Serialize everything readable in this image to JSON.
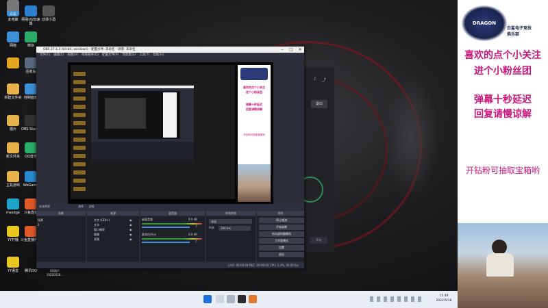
{
  "desktop": {
    "icons": [
      {
        "label": "此电脑",
        "color": "#3d8fd6"
      },
      {
        "label": "网易UU加速器",
        "color": "#2d7fd1"
      },
      {
        "label": "动漫小酒",
        "color": "#555"
      },
      {
        "label": "网络",
        "color": "#3d8fd6"
      },
      {
        "label": "微信",
        "color": "#2aae67"
      },
      {
        "label": "",
        "color": "#e1a520"
      },
      {
        "label": "回收站",
        "color": "#5a6a80"
      },
      {
        "label": "新建文件夹",
        "color": "#e8b34a"
      },
      {
        "label": "控制面板",
        "color": "#3d8fd6"
      },
      {
        "label": "图片",
        "color": "#e8b34a"
      },
      {
        "label": "OBS Studio",
        "color": "#333"
      },
      {
        "label": "新文件夹",
        "color": "#e8b34a"
      },
      {
        "label": "QQ音乐",
        "color": "#2aae67"
      },
      {
        "label": "主机游戏",
        "color": "#e8b34a"
      },
      {
        "label": "WeGame",
        "color": "#2a8ad1"
      },
      {
        "label": "msedge",
        "color": "#1fa3c9"
      },
      {
        "label": "斗鱼直播",
        "color": "#e05a2a"
      },
      {
        "label": "YY开播",
        "color": "#e8c820"
      },
      {
        "label": "斗鱼直播伴侣",
        "color": "#e05a2a"
      },
      {
        "label": "YY语音",
        "color": "#e8c820"
      },
      {
        "label": "腾讯QQ",
        "color": "#111"
      },
      {
        "label": "白鲨",
        "color": "#777"
      }
    ],
    "file_caption": "QQ图片\n20220518..."
  },
  "obs": {
    "title": "OBS 27.1.3 (64-bit, windows) - 配置文件: 未命名 - 场景: 未命名",
    "menu": [
      "文件(F)",
      "编辑(E)",
      "视图(V)",
      "停靠部件(D)",
      "配置文件(P)",
      "场景集(S)",
      "工具(T)",
      "帮助(H)"
    ],
    "status_bar": "未选择源",
    "props_label": "属性",
    "filters_label": "滤镜",
    "panels": {
      "scenes": "场景",
      "sources": "来源",
      "mixer": "混音器",
      "transitions": "转场特效",
      "controls": "控件"
    },
    "scenes": [
      "场景",
      "2"
    ],
    "sources": [
      "文字 (GDI+)",
      "文字",
      "窗口捕获",
      "图像",
      "背景"
    ],
    "mixer": [
      {
        "name": "桌面音频",
        "level": "0.0 dB"
      },
      {
        "name": "麦克风/Aux",
        "level": "0.0 dB"
      }
    ],
    "transition": {
      "type": "淡出",
      "duration_label": "时长",
      "duration": "300 ms"
    },
    "controls": [
      "停止推流",
      "开始录制",
      "启动虚拟摄像机",
      "工作室模式",
      "设置",
      "退出"
    ],
    "stats": "LIVE: 00:00:00   REC: 00:00:00   CPU: 5.3%, 30.00 fps"
  },
  "stream_overlay": {
    "logo_top": "DRAGON",
    "club_line1": "白鲨电子竞技",
    "club_line2": "俱乐部",
    "line1": "喜欢的点个小关注",
    "line2": "进个小粉丝团",
    "line3": "弹幕十秒延迟",
    "line4": "回复请慢谅解",
    "line5": "开钻粉可抽取宝箱哟",
    "accent_color": "#c8167a"
  },
  "taskbar": {
    "time": "15:48",
    "date": "2022/5/18"
  },
  "background_app": {
    "button": "退出",
    "side_label": "开始"
  }
}
